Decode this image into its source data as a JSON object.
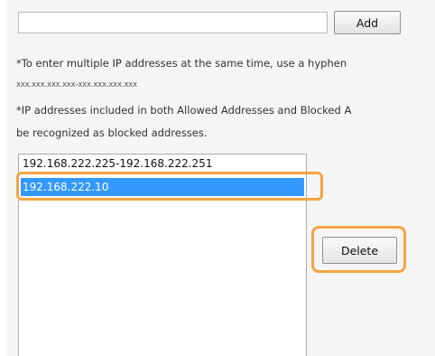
{
  "ip_entry": {
    "value": "",
    "add_label": "Add"
  },
  "notes": {
    "multiple_ip": "*To enter multiple IP addresses at the same time, use a hyphen",
    "format": "xxx.xxx.xxx.xxx-xxx.xxx.xxx.xxx",
    "blocked_line1": "*IP addresses included in both Allowed Addresses and Blocked A",
    "blocked_line2": "be recognized as blocked addresses."
  },
  "address_list": {
    "items": [
      "192.168.222.225-192.168.222.251",
      "192.168.222.10"
    ],
    "selected_index": 1
  },
  "delete_label": "Delete",
  "colors": {
    "highlight_outline": "#f2a541",
    "selection_background": "#3399ff"
  }
}
